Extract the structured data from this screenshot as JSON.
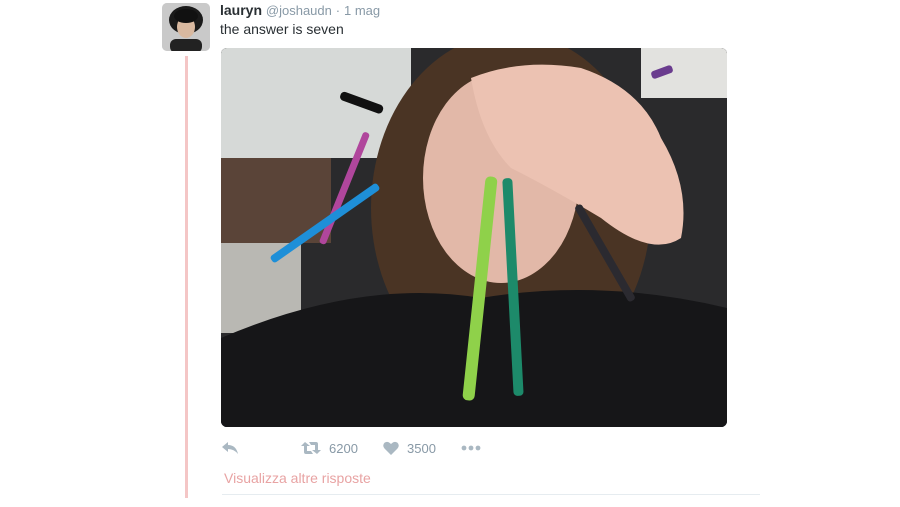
{
  "tweet": {
    "display_name": "lauryn",
    "handle": "@joshaudn",
    "separator": "·",
    "time": "1 mag",
    "text": "the answer is seven",
    "avatar_icon": "user-avatar",
    "media_description_icon": "photo"
  },
  "actions": {
    "reply_icon": "reply-icon",
    "retweet_icon": "retweet-icon",
    "retweet_count": "6200",
    "like_icon": "heart-icon",
    "like_count": "3500",
    "more_icon": "more-icon"
  },
  "thread": {
    "more_replies_label": "Visualizza altre risposte"
  },
  "colors": {
    "thread_line": "#f4c6c6",
    "more_replies": "#e8a3a3",
    "action_gray": "#8899a6"
  }
}
